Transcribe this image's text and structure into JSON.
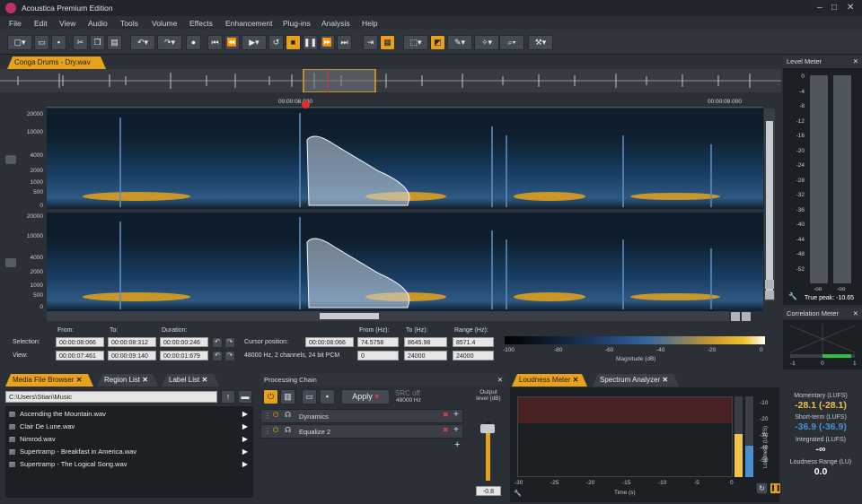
{
  "app": {
    "title": "Acoustica Premium Edition"
  },
  "menu": [
    "File",
    "Edit",
    "View",
    "Audio",
    "Tools",
    "Volume",
    "Effects",
    "Enhancement",
    "Plug-ins",
    "Analysis",
    "Help"
  ],
  "document_tab": "Conga Drums - Dry.wav",
  "timeline": {
    "t1": "00:00:08.000",
    "t2": "00:00:09.000"
  },
  "freq_axis": [
    "20000",
    "10000",
    "4000",
    "2000",
    "1000",
    "500",
    "0"
  ],
  "selection": {
    "col_from": "From:",
    "col_to": "To:",
    "col_duration": "Duration:",
    "row_selection": "Selection:",
    "row_view": "View:",
    "sel_from": "00:00:08:066",
    "sel_to": "00:00:08:312",
    "sel_duration": "00:00:00:246",
    "view_from": "00:00:07:461",
    "view_to": "00:00:09:140",
    "view_duration": "00:00:01:679",
    "cursor_label": "Cursor position:",
    "cursor_value": "00:00:08:066",
    "format": "48000 Hz, 2 channels, 24 bit PCM",
    "col_from_hz": "From (Hz):",
    "col_to_hz": "To (Hz):",
    "col_range_hz": "Range (Hz):",
    "from_hz": "74.5758",
    "to_hz": "8645.98",
    "range_hz": "8571.4",
    "from_hz2": "0",
    "to_hz2": "24000",
    "range_hz2": "24000"
  },
  "magnitude": {
    "ticks": [
      "-100",
      "-80",
      "-60",
      "-40",
      "-20",
      "0"
    ],
    "label": "Magnitude (dB)"
  },
  "level_meter": {
    "title": "Level Meter",
    "scale": [
      "0",
      "-4",
      "-8",
      "-12",
      "-16",
      "-20",
      "-24",
      "-28",
      "-32",
      "-36",
      "-40",
      "-44",
      "-48",
      "-52"
    ],
    "left_value": "-oo",
    "right_value": "-oo",
    "true_peak": "True peak: -10.65"
  },
  "correlation": {
    "title": "Correlation Meter",
    "ticks": [
      "-1",
      "0",
      "1"
    ]
  },
  "media_browser": {
    "tabs": [
      "Media File Browser",
      "Region List",
      "Label List"
    ],
    "path": "C:\\Users\\Stian\\Music",
    "files": [
      "Ascending the Mountain.wav",
      "Clair De Lune.wav",
      "Nimrod.wav",
      "Supertramp - Breakfast in America.wav",
      "Supertramp - The Logical Song.wav"
    ]
  },
  "processing": {
    "title": "Processing Chain",
    "apply": "Apply",
    "src": "SRC off",
    "src_rate": "48000 Hz",
    "output_label": "Output level (dB)",
    "output_value": "-0.8",
    "items": [
      "Dynamics",
      "Equalize 2"
    ]
  },
  "loudness": {
    "tabs": [
      "Loudness Meter",
      "Spectrum Analyzer"
    ],
    "x_ticks": [
      "-30",
      "-25",
      "-20",
      "-15",
      "-10",
      "-5",
      "0"
    ],
    "x_label": "Time (s)",
    "y_ticks": [
      "-10",
      "-20",
      "-30",
      "-40",
      "-50"
    ],
    "y_label": "Loudness (LUFS)",
    "momentary_label": "Momentary (LUFS)",
    "momentary_value": "-28.1 (-28.1)",
    "short_label": "Short-term (LUFS)",
    "short_value": "-36.9 (-36.9)",
    "integrated_label": "Integrated (LUFS)",
    "integrated_value": "-∞",
    "range_label": "Loudness Range (LU)",
    "range_value": "0.0"
  },
  "colors": {
    "accent": "#e8a21a",
    "momentary": "#f0c24a",
    "short_term": "#4a90d0"
  }
}
